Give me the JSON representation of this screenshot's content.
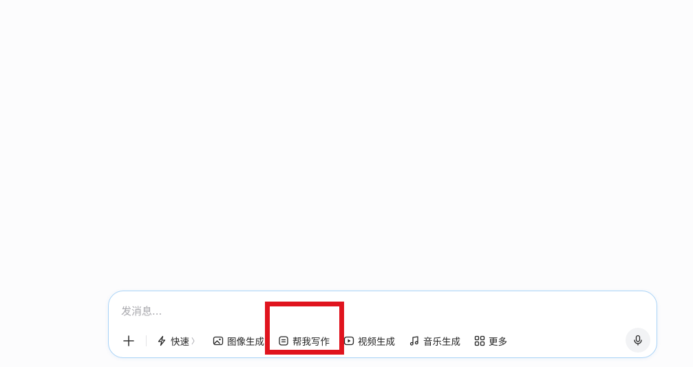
{
  "composer": {
    "placeholder": "发消息...",
    "value": ""
  },
  "toolbar": {
    "plus_icon": "plus-icon",
    "tools": [
      {
        "label": "快速",
        "icon": "lightning-icon",
        "has_chevron": true,
        "chevron": "〉"
      },
      {
        "label": "图像生成",
        "icon": "image-icon"
      },
      {
        "label": "帮我写作",
        "icon": "document-icon"
      },
      {
        "label": "视频生成",
        "icon": "video-play-icon"
      },
      {
        "label": "音乐生成",
        "icon": "music-note-icon"
      },
      {
        "label": "更多",
        "icon": "grid-icon"
      }
    ],
    "mic_icon": "microphone-icon"
  },
  "annotation": {
    "highlight_color": "#e0141e",
    "highlight_target": "帮我写作"
  },
  "colors": {
    "background": "#fcfcfd",
    "composer_border": "#a9d3f7",
    "placeholder": "#a8a8ad"
  }
}
